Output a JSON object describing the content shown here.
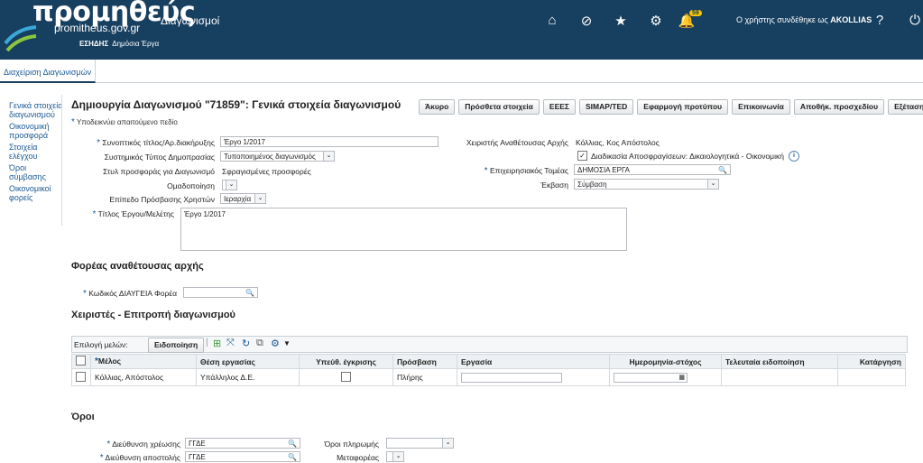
{
  "header": {
    "logo_text": "προμηθεύς",
    "logo_url": "promitheus.gov.gr",
    "logo_sub_bold": "ΕΣΗΔΗΣ",
    "logo_sub": "Δημόσια Έργα",
    "app_title": "Διαγωνισμοί",
    "notifications_count": "59",
    "user_prefix": "Ο χρήστης συνδέθηκε ως",
    "user_name": "AKOLLIAS",
    "icons": [
      "home-icon",
      "block-icon",
      "star-icon",
      "gear-icon",
      "bell-icon",
      "help-icon",
      "power-icon"
    ]
  },
  "tabs": [
    {
      "label": "Διαχείριση Διαγωνισμών"
    }
  ],
  "sidebar": {
    "items": [
      {
        "label": "Γενικά στοιχεία διαγωνισμού"
      },
      {
        "label": "Οικονομική προσφορά"
      },
      {
        "label": "Στοιχεία ελέγχου"
      },
      {
        "label": "Όροι σύμβασης"
      },
      {
        "label": "Οικονομικοί φορείς"
      }
    ]
  },
  "page": {
    "title": "Δημιουργία Διαγωνισμού \"71859\": Γενικά στοιχεία διαγωνισμού",
    "required_note": "Υποδεικνύει απαιτούμενο πεδίο",
    "buttons": [
      "Άκυρο",
      "Πρόσθετα στοιχεία",
      "ΕΕΕΣ",
      "SIMAP/TED",
      "Εφαρμογή προτύπου",
      "Επικοινωνία",
      "Αποθήκ. προσχεδίου",
      "Εξέταση"
    ]
  },
  "form": {
    "summary_label": "Συνοπτικός τίτλος/Αρ.διακήρυξης",
    "summary_value": "Έργο 1/2017",
    "system_type_label": "Συστημικός Τύπος Δημοπρασίας",
    "system_type_value": "Τυποποιημένος διαγωνισμός",
    "offer_style_label": "Στυλ προσφοράς για Διαγωνισμό",
    "offer_style_value": "Σφραγισμένες προσφορές",
    "grouping_label": "Ομαδοποίηση",
    "access_level_label": "Επίπεδο Πρόσβασης Χρηστών",
    "access_level_value": "Ιεραρχία",
    "project_title_label": "Τίτλος Έργου/Μελέτης",
    "project_title_value": "Έργο 1/2017",
    "manager_label": "Χειριστής Αναθέτουσας Αρχής",
    "manager_value": "Κόλλιας, Κος Απόστολος",
    "unsealing_label": "Διαδικασία Αποσφραγίσεων: Δικαιολογητικά - Οικονομική",
    "sector_label": "Επιχειρησιακός Τομέας",
    "sector_value": "ΔΗΜΟΣΙΑ ΕΡΓΑ",
    "outcome_label": "Έκβαση",
    "outcome_value": "Σύμβαση"
  },
  "authority": {
    "title": "Φορέας αναθέτουσας αρχής",
    "diavgeia_label": "Κωδικός ΔΙΑΥΓΕΙΑ Φορέα",
    "diavgeia_value": ""
  },
  "committee": {
    "title": "Χειριστές - Επιτροπή διαγωνισμού",
    "select_members_label": "Επιλογή μελών:",
    "notify_button": "Ειδοποίηση",
    "columns": [
      "Μέλος",
      "Θέση εργασίας",
      "Υπεύθ. έγκρισης",
      "Πρόσβαση",
      "Εργασία",
      "Ημερομηνία-στόχος",
      "Τελευταία ειδοποίηση",
      "Κατάργηση"
    ],
    "rows": [
      {
        "member": "Κόλλιας, Απόστολος",
        "position": "Υπάλληλος Δ.Ε.",
        "access": "Πλήρης"
      }
    ]
  },
  "terms": {
    "title": "Όροι",
    "billing_label": "Διεύθυνση χρέωσης",
    "billing_value": "ΓΓΔΕ",
    "shipping_label": "Διεύθυνση αποστολής",
    "shipping_value": "ΓΓΔΕ",
    "payment_terms_label": "Όροι πληρωμής",
    "carrier_label": "Μεταφορέας"
  },
  "colors": {
    "header_bg": "#173f5f",
    "link": "#1a5a96",
    "badge": "#f5c400"
  }
}
